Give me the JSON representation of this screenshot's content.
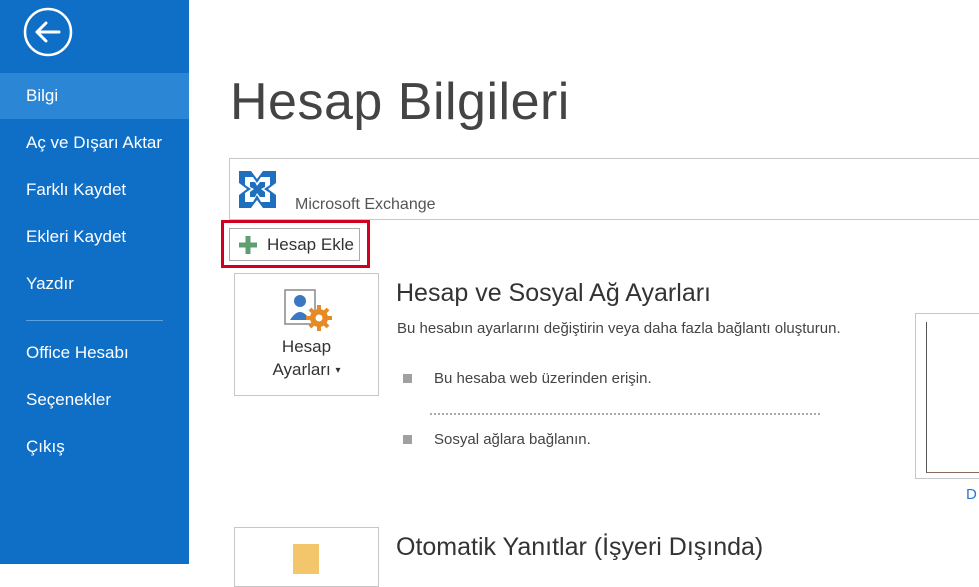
{
  "sidebar": {
    "items": [
      {
        "label": "Bilgi"
      },
      {
        "label": "Aç ve Dışarı Aktar"
      },
      {
        "label": "Farklı Kaydet"
      },
      {
        "label": "Ekleri Kaydet"
      },
      {
        "label": "Yazdır"
      },
      {
        "label": "Office Hesabı"
      },
      {
        "label": "Seçenekler"
      },
      {
        "label": "Çıkış"
      }
    ],
    "back_icon": "back-arrow-icon",
    "background": "#0f6fc6",
    "active_background": "#2c86d6"
  },
  "main": {
    "title": "Hesap Bilgileri",
    "account": {
      "type": "Microsoft Exchange",
      "icon": "exchange-icon"
    },
    "add_account_label": "Hesap Ekle",
    "sections": [
      {
        "tile_line1": "Hesap",
        "tile_line2": "Ayarları",
        "title": "Hesap ve Sosyal Ağ Ayarları",
        "description": "Bu hesabın ayarlarını değiştirin veya daha fazla bağlantı oluşturun.",
        "bullets": [
          "Bu hesaba web üzerinden erişin.",
          "Sosyal ağlara bağlanın."
        ]
      },
      {
        "title": "Otomatik Yanıtlar (İşyeri Dışında)"
      }
    ],
    "preview_link": "D"
  },
  "colors": {
    "highlight": "#d1001f",
    "link": "#2b79c6"
  }
}
